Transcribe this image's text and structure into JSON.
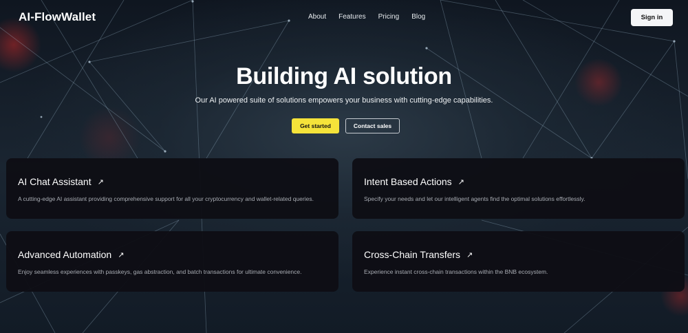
{
  "brand": {
    "name": "AI-FlowWallet"
  },
  "nav": {
    "items": [
      "About",
      "Features",
      "Pricing",
      "Blog"
    ]
  },
  "header": {
    "signin_label": "Sign in"
  },
  "hero": {
    "title": "Building AI solution",
    "subtitle": "Our AI powered suite of solutions empowers your business with cutting-edge capabilities.",
    "primary_label": "Get started",
    "secondary_label": "Contact sales"
  },
  "colors": {
    "accent": "#f5e33a",
    "card_bg": "#0e0e14",
    "text_muted": "#a9adb4"
  },
  "cards": [
    {
      "title": "AI Chat Assistant",
      "icon": "arrow-up-right-icon",
      "desc": "A cutting-edge AI assistant providing comprehensive support for all your cryptocurrency and wallet-related queries."
    },
    {
      "title": "Intent Based Actions",
      "icon": "arrow-up-right-icon",
      "desc": "Specify your needs and let our intelligent agents find the optimal solutions effortlessly."
    },
    {
      "title": "Advanced Automation",
      "icon": "arrow-up-right-icon",
      "desc": "Enjoy seamless experiences with passkeys, gas abstraction, and batch transactions for ultimate convenience."
    },
    {
      "title": "Cross-Chain Transfers",
      "icon": "arrow-up-right-icon",
      "desc": "Experience instant cross-chain transactions within the BNB ecosystem."
    }
  ]
}
